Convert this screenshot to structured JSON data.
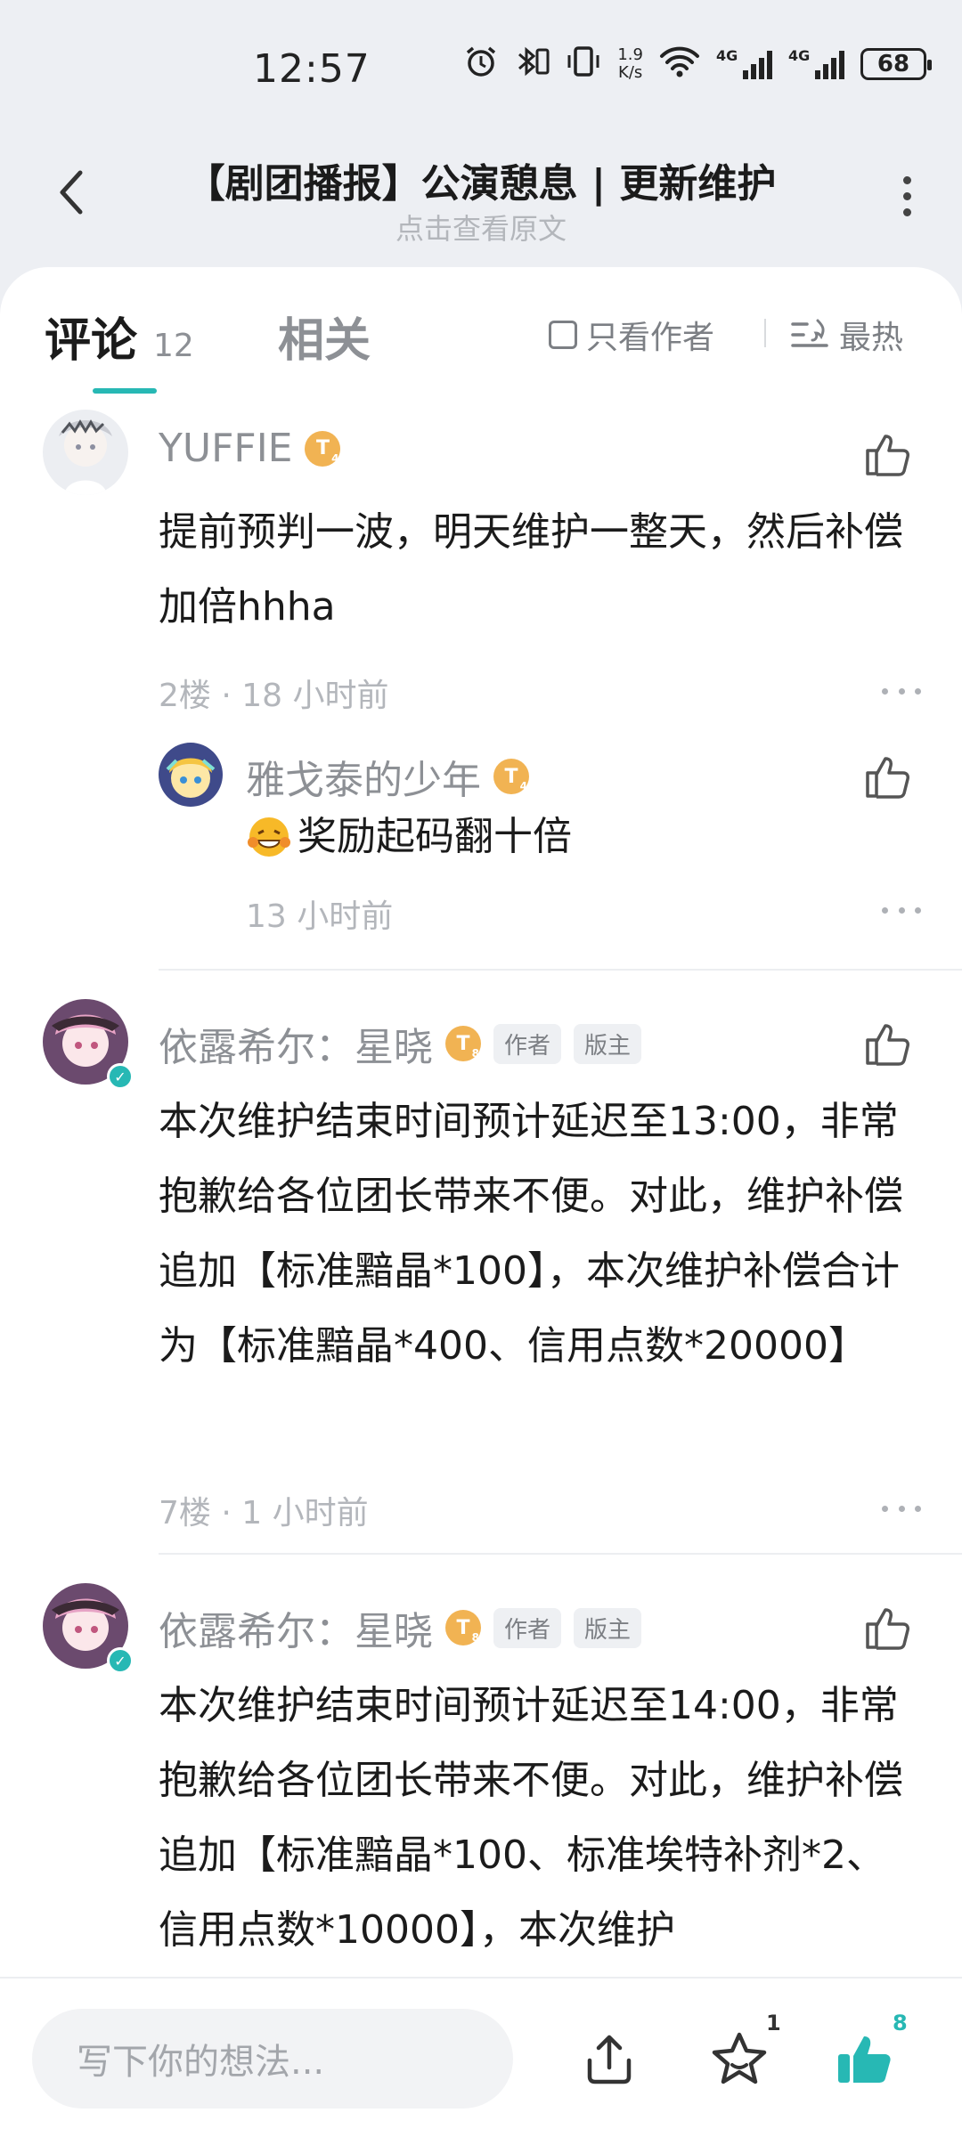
{
  "status_bar": {
    "time": "12:57",
    "net_speed_value": "1.9",
    "net_speed_unit": "K/s",
    "signal1_label": "4G",
    "signal2_label": "4G",
    "battery": "68",
    "icons": [
      "alarm-icon",
      "bluetooth-icon",
      "vibrate-icon",
      "wifi-icon"
    ]
  },
  "header": {
    "title": "【剧团播报】公演憩息 | 更新维护",
    "subtitle": "点击查看原文"
  },
  "tabs": {
    "comments_label": "评论",
    "comments_count": "12",
    "related_label": "相关",
    "author_only_label": "只看作者",
    "sort_label": "最热",
    "accent_color": "#27b8b4"
  },
  "comments": [
    {
      "username": "YUFFIE",
      "level": "T",
      "level_num": "4",
      "text": "提前预判一波，明天维护一整天，然后补偿加倍hhha",
      "floor": "2楼",
      "sep": "·",
      "time": "18 小时前",
      "reply": {
        "username": "雅戈泰的少年",
        "level": "T",
        "level_num": "4",
        "text": "奖励起码翻十倍",
        "time": "13 小时前"
      }
    },
    {
      "username": "依露希尔：星晓",
      "level": "T",
      "level_num": "8",
      "tag_author": "作者",
      "tag_mod": "版主",
      "text": "本次维护结束时间预计延迟至13:00，非常抱歉给各位团长带来不便。对此，维护补偿追加【标准黯晶*100】，本次维护补偿合计为【标准黯晶*400、信用点数*20000】",
      "floor": "7楼",
      "sep": "·",
      "time": "1 小时前"
    },
    {
      "username": "依露希尔：星晓",
      "level": "T",
      "level_num": "8",
      "tag_author": "作者",
      "tag_mod": "版主",
      "text": "本次维护结束时间预计延迟至14:00，非常抱歉给各位团长带来不便。对此，维护补偿追加【标准黯晶*100、标准埃特补剂*2、信用点数*10000】，本次维护"
    }
  ],
  "bottom_bar": {
    "input_placeholder": "写下你的想法...",
    "favorite_count": "1",
    "like_count": "8",
    "like_color": "#27b8b4"
  }
}
